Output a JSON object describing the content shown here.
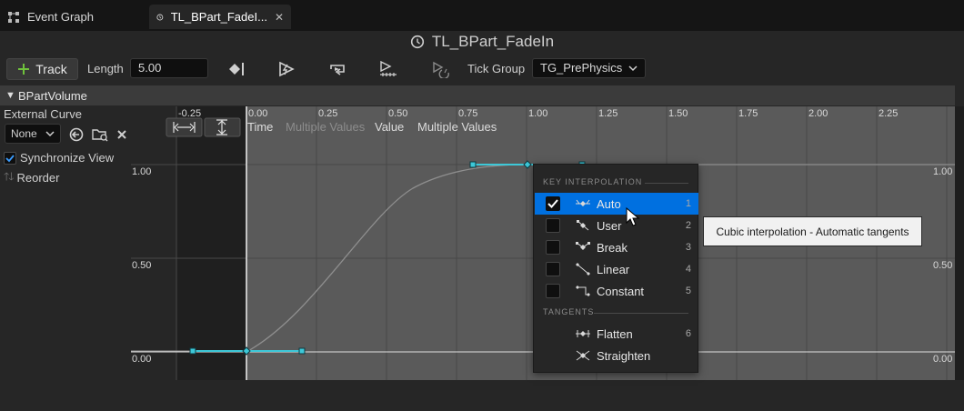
{
  "tabs": [
    {
      "label": "Event Graph",
      "icon": "graph-icon"
    },
    {
      "label": "TL_BPart_FadeI...",
      "icon": "clock-icon",
      "close": "✕"
    }
  ],
  "title": "TL_BPart_FadeIn",
  "toolbar": {
    "track_label": "Track",
    "length_label": "Length",
    "length_value": "5.00",
    "tick_group_label": "Tick Group",
    "tick_group_value": "TG_PrePhysics"
  },
  "track": {
    "name": "BPartVolume",
    "external_curve_label": "External Curve",
    "curve_select": "None",
    "sync_view_label": "Synchronize View",
    "reorder_label": "Reorder"
  },
  "graph": {
    "x_ticks": [
      "-0.25",
      "0.00",
      "0.25",
      "0.50",
      "0.75",
      "1.00",
      "1.25",
      "1.50",
      "1.75",
      "2.00",
      "2.25"
    ],
    "y_ticks": [
      "1.00",
      "0.50",
      "0.00"
    ],
    "time_label": "Time",
    "time_value": "Multiple Values",
    "value_label": "Value",
    "value_value": "Multiple Values"
  },
  "menu": {
    "heading1": "KEY INTERPOLATION",
    "items": [
      {
        "label": "Auto",
        "key": "1",
        "checked": true,
        "icon": "auto-tangent-icon"
      },
      {
        "label": "User",
        "key": "2",
        "checked": false,
        "icon": "user-tangent-icon"
      },
      {
        "label": "Break",
        "key": "3",
        "checked": false,
        "icon": "break-tangent-icon"
      },
      {
        "label": "Linear",
        "key": "4",
        "checked": false,
        "icon": "linear-interp-icon"
      },
      {
        "label": "Constant",
        "key": "5",
        "checked": false,
        "icon": "constant-interp-icon"
      }
    ],
    "heading2": "TANGENTS",
    "tangent_items": [
      {
        "label": "Flatten",
        "key": "6",
        "icon": "flatten-icon"
      },
      {
        "label": "Straighten",
        "key": "",
        "icon": "straighten-icon"
      }
    ]
  },
  "tooltip": "Cubic interpolation - Automatic tangents",
  "colors": {
    "accent": "#0070e0",
    "key": "#3dc8d8",
    "curve": "#9a9a9a"
  }
}
